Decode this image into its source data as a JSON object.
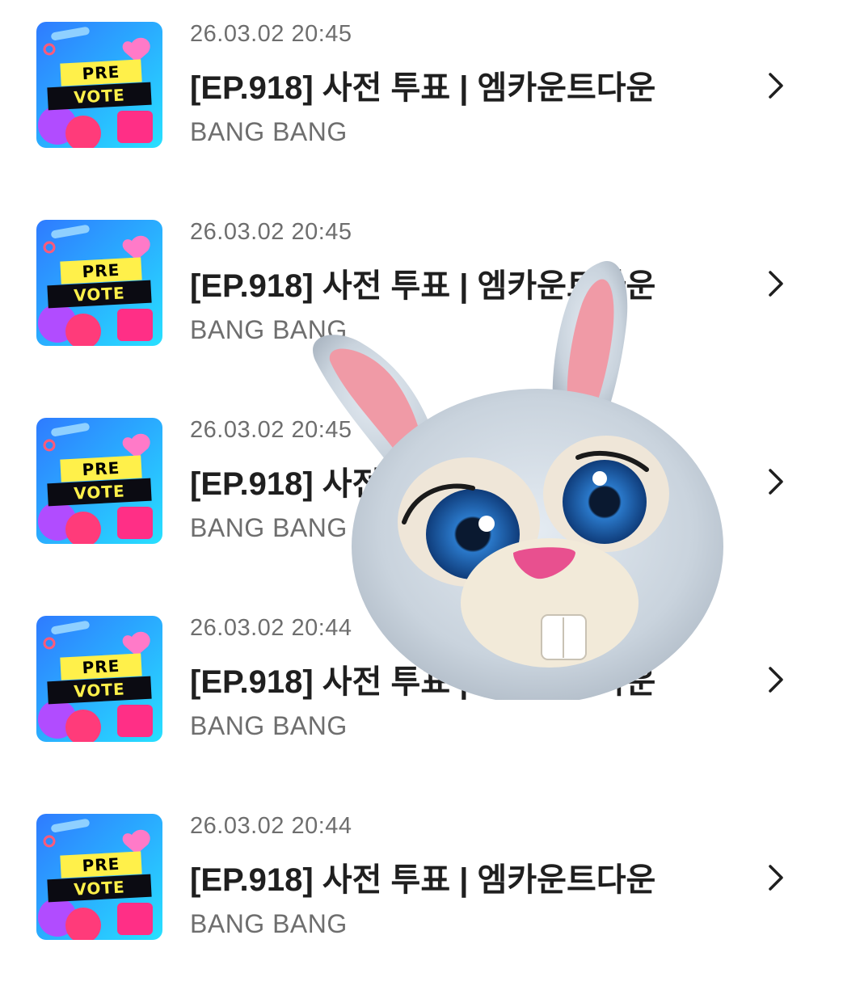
{
  "items": [
    {
      "time": "26.03.02 20:45",
      "title": "[EP.918] 사전 투표 | 엠카운트다운",
      "artist": "BANG BANG",
      "thumb_top": "PRE",
      "thumb_bottom": "VOTE"
    },
    {
      "time": "26.03.02 20:45",
      "title": "[EP.918] 사전 투표 | 엠카운트다운",
      "artist": "BANG BANG",
      "thumb_top": "PRE",
      "thumb_bottom": "VOTE"
    },
    {
      "time": "26.03.02 20:45",
      "title": "[EP.918] 사전 투표 | 엠카운트다운",
      "artist": "BANG BANG",
      "thumb_top": "PRE",
      "thumb_bottom": "VOTE"
    },
    {
      "time": "26.03.02 20:44",
      "title": "[EP.918] 사전 투표 | 엠카운트다운",
      "artist": "BANG BANG",
      "thumb_top": "PRE",
      "thumb_bottom": "VOTE"
    },
    {
      "time": "26.03.02 20:44",
      "title": "[EP.918] 사전 투표 | 엠카운트다운",
      "artist": "BANG BANG",
      "thumb_top": "PRE",
      "thumb_bottom": "VOTE"
    }
  ],
  "icons": {
    "row_chevron": "chevron-right-icon",
    "overlay": "bunny-sticker"
  },
  "colors": {
    "title": "#1f1f1f",
    "meta": "#6e6e6e",
    "thumb_yellow": "#fff04a",
    "thumb_black": "#0b0b12"
  }
}
